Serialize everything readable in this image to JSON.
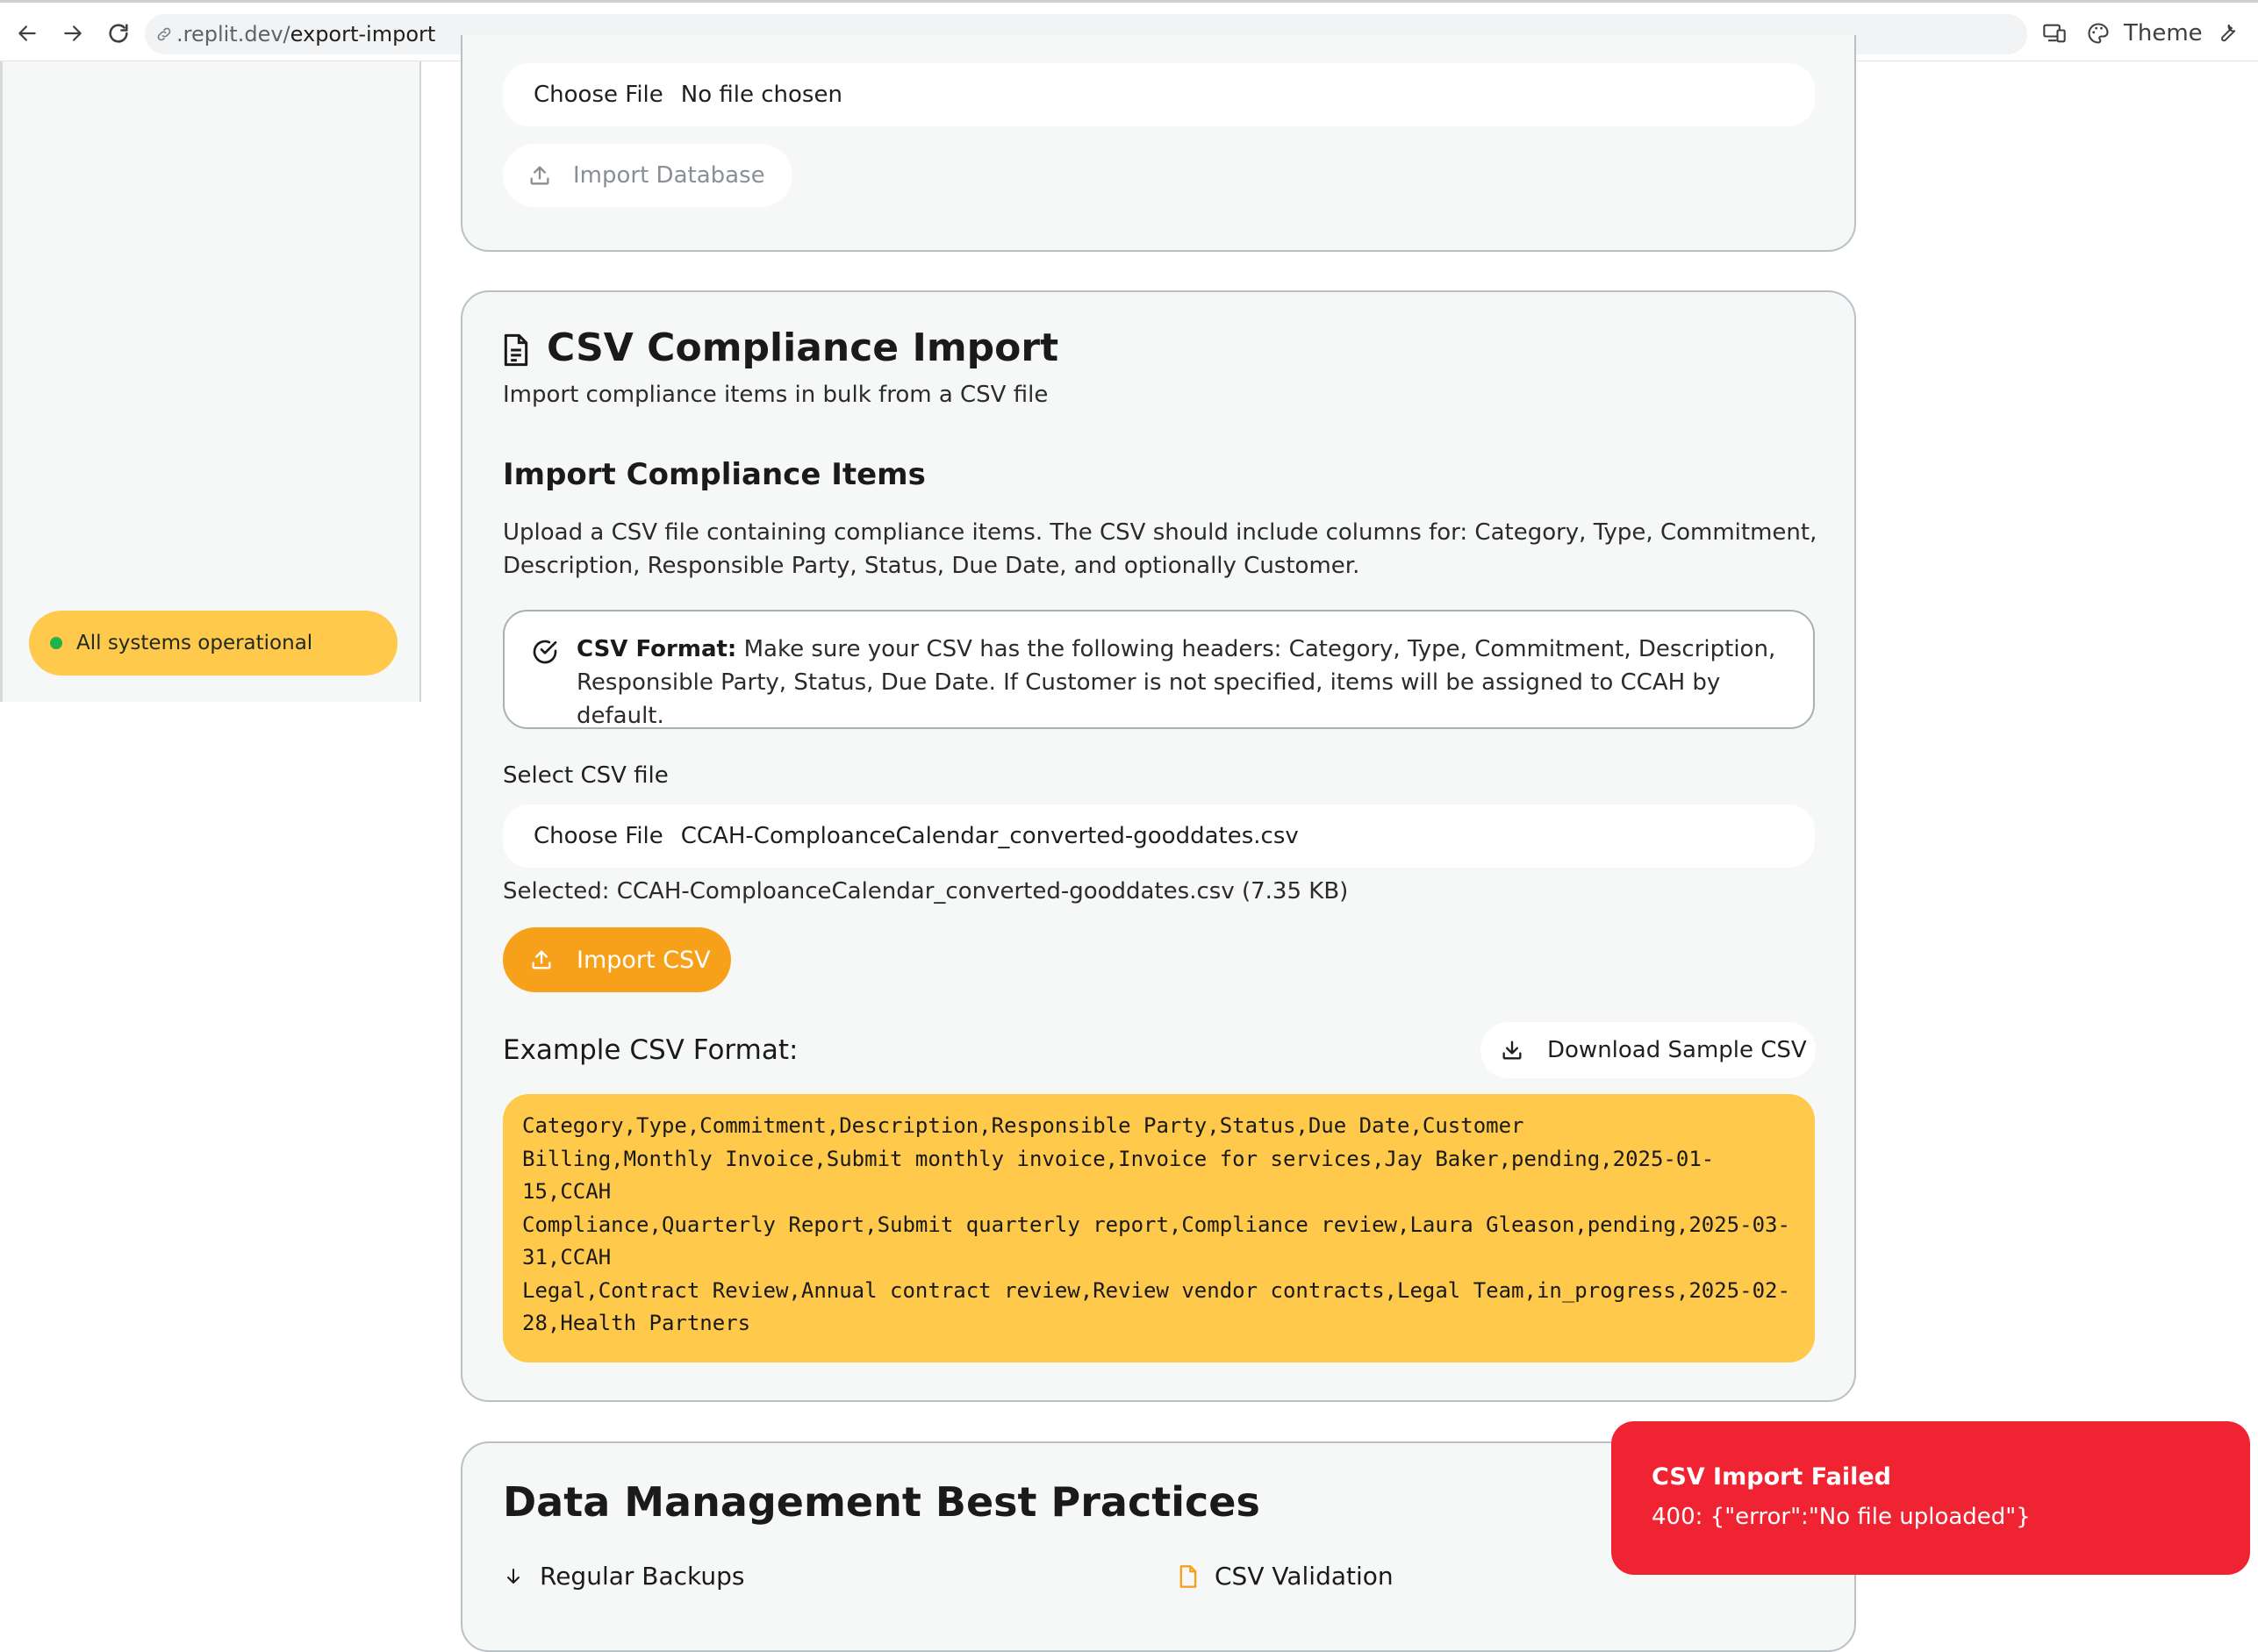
{
  "browser": {
    "url_prefix": ".replit.dev/",
    "url_path": "export-import",
    "theme_label": "Theme"
  },
  "sidebar": {
    "status_text": "All systems operational",
    "status_color": "#22b24c"
  },
  "db_import": {
    "choose_label": "Choose File",
    "file_status": "No file chosen",
    "button_label": "Import Database"
  },
  "csv_import": {
    "title": "CSV Compliance Import",
    "subtitle": "Import compliance items in bulk from a CSV file",
    "section_title": "Import Compliance Items",
    "description": "Upload a CSV file containing compliance items. The CSV should include columns for: Category, Type, Commitment, Description, Responsible Party, Status, Due Date, and optionally Customer.",
    "alert_bold": "CSV Format:",
    "alert_text": " Make sure your CSV has the following headers: Category, Type, Commitment, Description, Responsible Party, Status, Due Date. If Customer is not specified, items will be assigned to CCAH by default.",
    "select_label": "Select CSV file",
    "choose_label": "Choose File",
    "file_name": "CCAH-ComploanceCalendar_converted-gooddates.csv",
    "selected_info": "Selected: CCAH-ComploanceCalendar_converted-gooddates.csv (7.35 KB)",
    "import_button": "Import CSV",
    "example_label": "Example CSV Format:",
    "download_button": "Download Sample CSV",
    "example_lines": [
      "Category,Type,Commitment,Description,Responsible Party,Status,Due Date,Customer",
      "Billing,Monthly Invoice,Submit monthly invoice,Invoice for services,Jay Baker,pending,2025-01-",
      "15,CCAH",
      "Compliance,Quarterly Report,Submit quarterly report,Compliance review,Laura Gleason,pending,2025-03-",
      "31,CCAH",
      "Legal,Contract Review,Annual contract review,Review vendor contracts,Legal Team,in_progress,2025-02-",
      "28,Health Partners"
    ]
  },
  "best_practices": {
    "title": "Data Management Best Practices",
    "col1": "Regular Backups",
    "col2": "CSV Validation"
  },
  "toast": {
    "title": "CSV Import Failed",
    "message": "400: {\"error\":\"No file uploaded\"}"
  },
  "colors": {
    "accent": "#f7a11a",
    "highlight": "#ffc94b",
    "error": "#ef2332"
  }
}
